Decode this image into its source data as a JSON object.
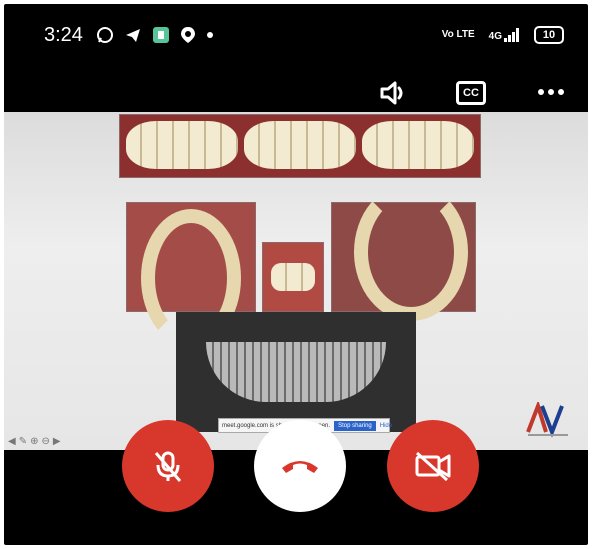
{
  "status_bar": {
    "time": "3:24",
    "network_label": "Vo LTE",
    "signal_label": "4G",
    "battery": "10",
    "notification_icons": [
      "whatsapp-icon",
      "telegram-icon",
      "app-icon",
      "maps-icon",
      "dot-icon"
    ]
  },
  "call_toolbar": {
    "icons": [
      "speaker-icon",
      "captions-icon",
      "more-options-icon"
    ],
    "captions_label": "CC"
  },
  "shared_screen": {
    "share_message": "meet.google.com is sharing your screen.",
    "stop_button": "Stop sharing",
    "hide_button": "Hide"
  },
  "call_controls": {
    "icons": [
      "microphone-off-icon",
      "end-call-icon",
      "camera-off-icon"
    ]
  },
  "colors": {
    "control_red": "#d8372c",
    "background": "#000000",
    "accent_blue": "#2a63c9"
  }
}
